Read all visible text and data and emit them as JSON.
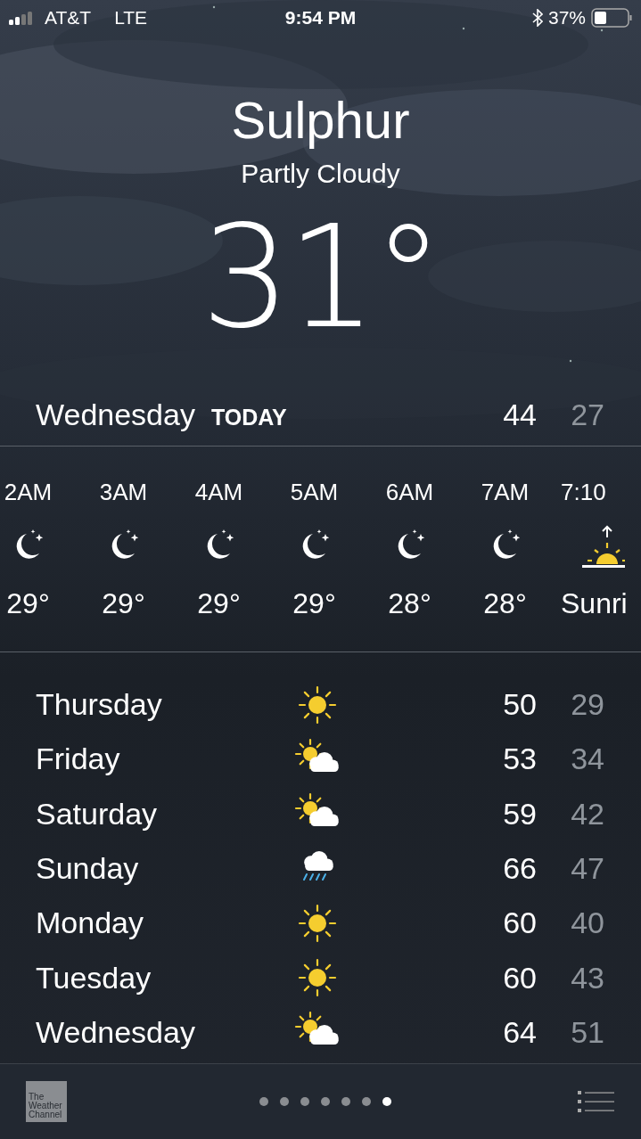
{
  "status_bar": {
    "carrier": "AT&T",
    "network": "LTE",
    "time": "9:54 PM",
    "battery": "37%"
  },
  "location": {
    "city": "Sulphur",
    "condition": "Partly Cloudy",
    "temperature": "31°"
  },
  "today": {
    "day": "Wednesday",
    "label": "TODAY",
    "high": "44",
    "low": "27"
  },
  "hourly": [
    {
      "kind": "moon",
      "time": "2AM",
      "temp": "29°"
    },
    {
      "kind": "moon",
      "time": "3AM",
      "temp": "29°"
    },
    {
      "kind": "moon",
      "time": "4AM",
      "temp": "29°"
    },
    {
      "kind": "moon",
      "time": "5AM",
      "temp": "29°"
    },
    {
      "kind": "moon",
      "time": "6AM",
      "temp": "28°"
    },
    {
      "kind": "moon",
      "time": "7AM",
      "temp": "28°"
    },
    {
      "kind": "sunrise",
      "time": "7:10",
      "temp": "Sunri"
    }
  ],
  "daily": [
    {
      "day": "Thursday",
      "kind": "sun",
      "high": "50",
      "low": "29"
    },
    {
      "day": "Friday",
      "kind": "partly",
      "high": "53",
      "low": "34"
    },
    {
      "day": "Saturday",
      "kind": "partly",
      "high": "59",
      "low": "42"
    },
    {
      "day": "Sunday",
      "kind": "rain",
      "high": "66",
      "low": "47"
    },
    {
      "day": "Monday",
      "kind": "sun",
      "high": "60",
      "low": "40"
    },
    {
      "day": "Tuesday",
      "kind": "sun",
      "high": "60",
      "low": "43"
    },
    {
      "day": "Wednesday",
      "kind": "partly",
      "high": "64",
      "low": "51"
    }
  ],
  "footer": {
    "logo": [
      "The",
      "Weather",
      "Channel"
    ],
    "pages": [
      {
        "selected": false
      },
      {
        "selected": false
      },
      {
        "selected": false
      },
      {
        "selected": false
      },
      {
        "selected": false
      },
      {
        "selected": false
      },
      {
        "selected": true
      }
    ]
  }
}
